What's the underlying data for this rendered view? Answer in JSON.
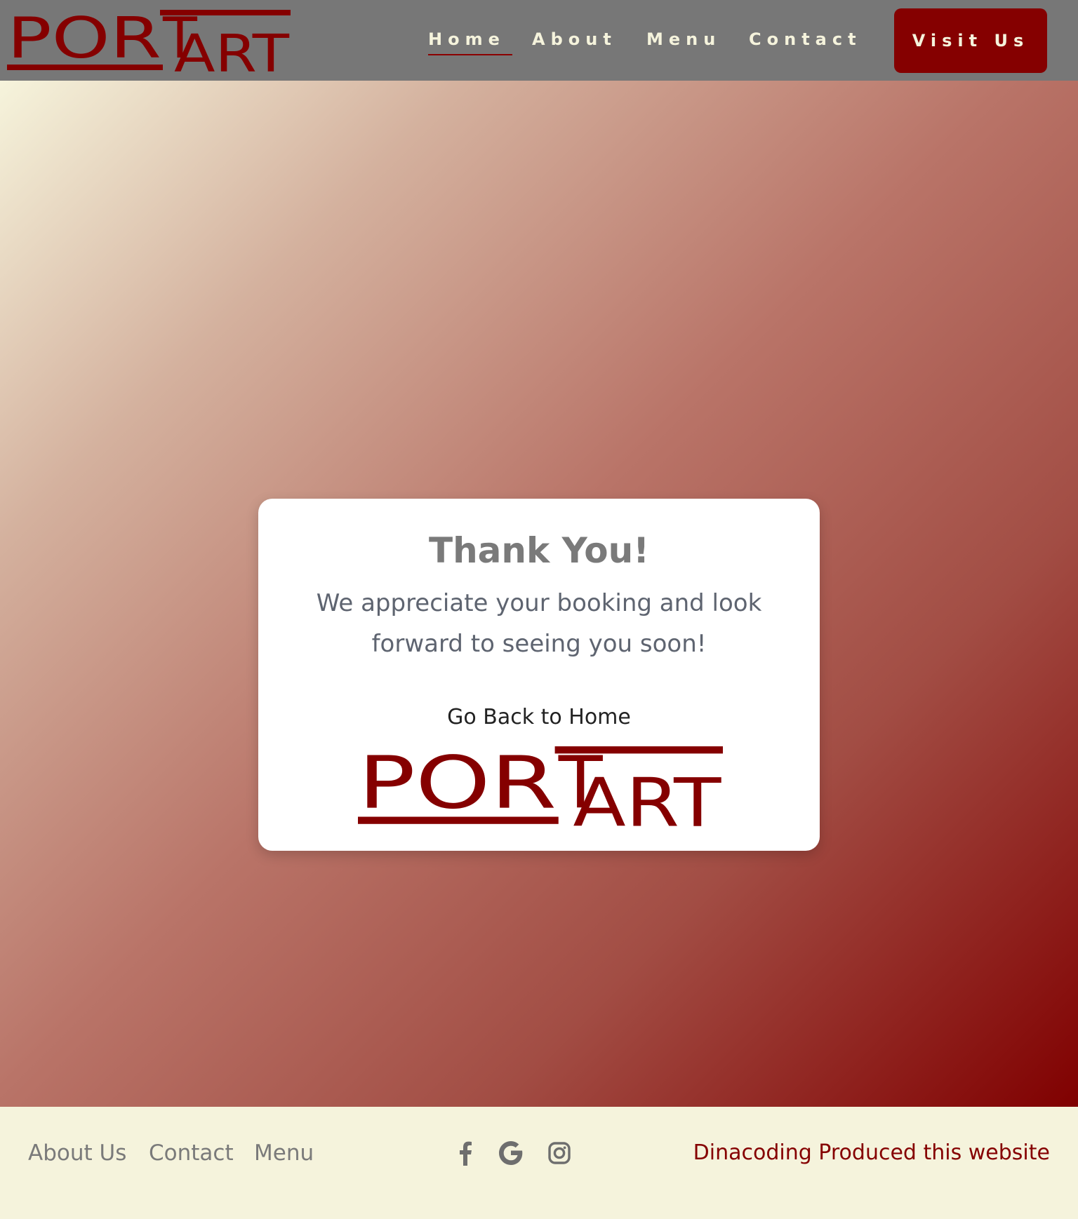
{
  "brand": {
    "name": "PORTART",
    "color": "#850000"
  },
  "nav": {
    "items": [
      {
        "label": "Home",
        "active": true
      },
      {
        "label": "About"
      },
      {
        "label": "Menu"
      },
      {
        "label": "Contact"
      }
    ],
    "cta_label": "Visit Us"
  },
  "card": {
    "title": "Thank You!",
    "message": "We appreciate your booking and look forward to seeing you soon!",
    "back_link": "Go Back to Home"
  },
  "footer": {
    "links": [
      "About Us",
      "Contact",
      "Menu"
    ],
    "social_icons": [
      "facebook-icon",
      "google-icon",
      "instagram-icon"
    ],
    "credit": "Dinacoding Produced this website"
  },
  "colors": {
    "header_bg": "#777777",
    "footer_bg": "#f5f3dc",
    "accent": "#850000",
    "gradient_start": "#f6f4dc",
    "gradient_end": "#800000"
  }
}
